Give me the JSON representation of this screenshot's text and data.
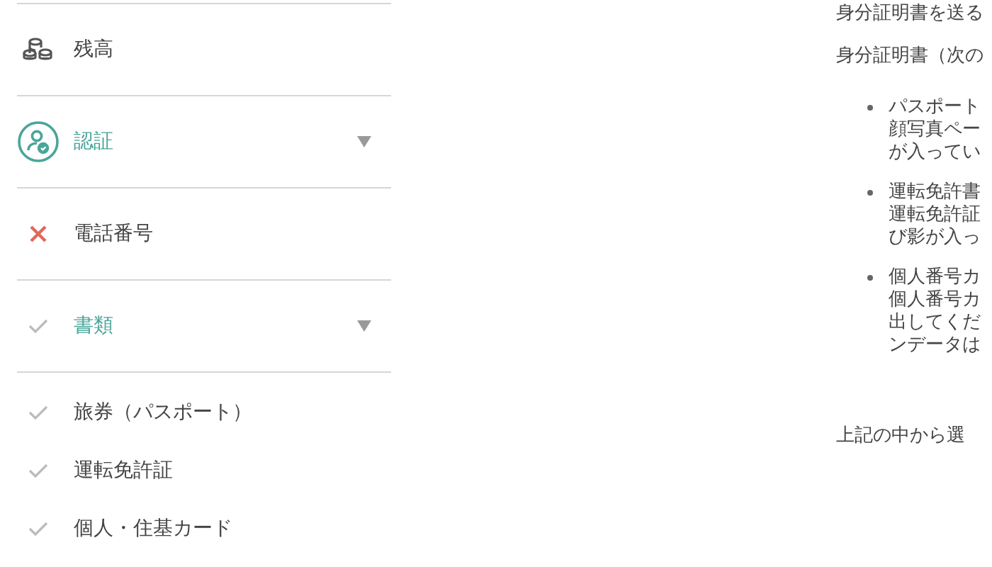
{
  "sidebar": {
    "items": [
      {
        "label": "残高",
        "kind": "coins",
        "highlighted": false
      },
      {
        "label": "認証",
        "kind": "user-check",
        "highlighted": true,
        "expanded": true
      },
      {
        "label": "電話番号",
        "kind": "cross",
        "highlighted": false
      },
      {
        "label": "書類",
        "kind": "check",
        "highlighted": true,
        "expanded": true,
        "children": [
          {
            "label": "旅券（パスポート）",
            "kind": "check"
          },
          {
            "label": "運転免許証",
            "kind": "check"
          },
          {
            "label": "個人・住基カード",
            "kind": "check"
          }
        ]
      }
    ]
  },
  "content": {
    "heading": "身分証明書を送る",
    "intro": "身分証明書（次の",
    "bullets": [
      [
        "パスポート",
        "顔写真ペー",
        "が入ってい"
      ],
      [
        "運転免許書",
        "運転免許証",
        "び影が入っ"
      ],
      [
        "個人番号カ",
        "個人番号カ",
        "出してくだ",
        "ンデータは"
      ]
    ],
    "footer": "上記の中から選"
  }
}
